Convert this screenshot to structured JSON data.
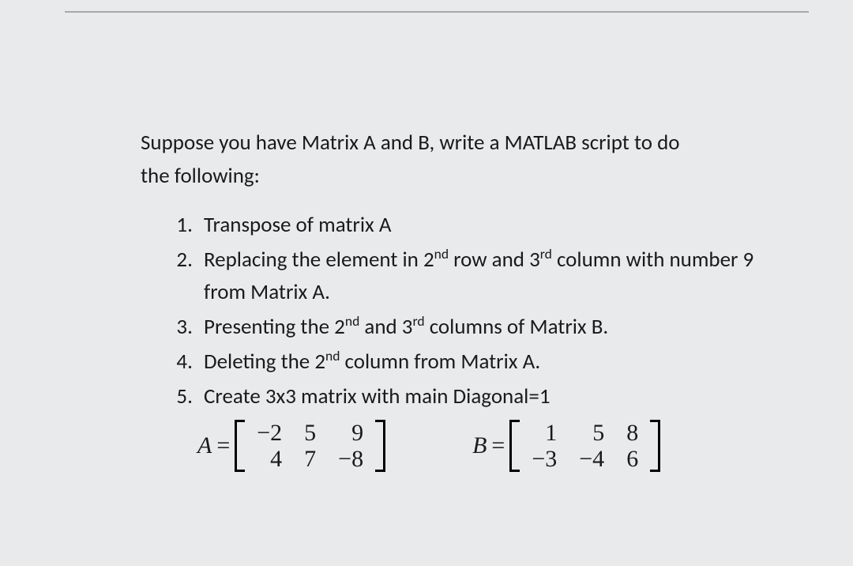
{
  "intro_line1": "Suppose you have Matrix A and B, write a MATLAB script to do",
  "intro_line2": "the following:",
  "tasks": {
    "t1": "Transpose of matrix A",
    "t2_a": "Replacing the element in 2",
    "t2_sup1": "nd",
    "t2_b": " row and 3",
    "t2_sup2": "rd",
    "t2_c": " column with number 9 from Matrix A.",
    "t3_a": "Presenting the 2",
    "t3_sup1": "nd",
    "t3_b": " and 3",
    "t3_sup2": "rd",
    "t3_c": " columns of Matrix B.",
    "t4_a": "Deleting the 2",
    "t4_sup1": "nd",
    "t4_b": " column from Matrix A.",
    "t5": "Create 3x3 matrix with main Diagonal=1"
  },
  "matrixA": {
    "label": "A",
    "eq": "=",
    "r0c0": "−2",
    "r0c1": "5",
    "r0c2": "9",
    "r1c0": "4",
    "r1c1": "7",
    "r1c2": "−8"
  },
  "matrixB": {
    "label": "B",
    "eq": "=",
    "r0c0": "1",
    "r0c1": "5",
    "r0c2": "8",
    "r1c0": "−3",
    "r1c1": "−4",
    "r1c2": "6"
  }
}
